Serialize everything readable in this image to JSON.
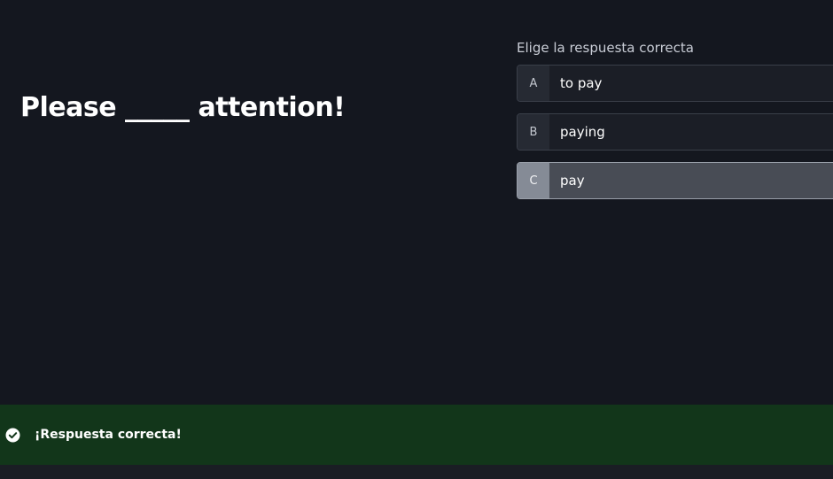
{
  "question": {
    "text": "Please _____ attention!"
  },
  "prompt": "Elige la respuesta correcta",
  "options": [
    {
      "key": "A",
      "text": "to pay",
      "selected": false
    },
    {
      "key": "B",
      "text": "paying",
      "selected": false
    },
    {
      "key": "C",
      "text": "pay",
      "selected": true
    }
  ],
  "feedback": {
    "message": "¡Respuesta correcta!",
    "status": "correct",
    "icon": "check-circle-icon",
    "color": "#12361a"
  },
  "colors": {
    "background": "#14171f",
    "selected_option": "#484c55",
    "success_banner": "#12361a"
  }
}
